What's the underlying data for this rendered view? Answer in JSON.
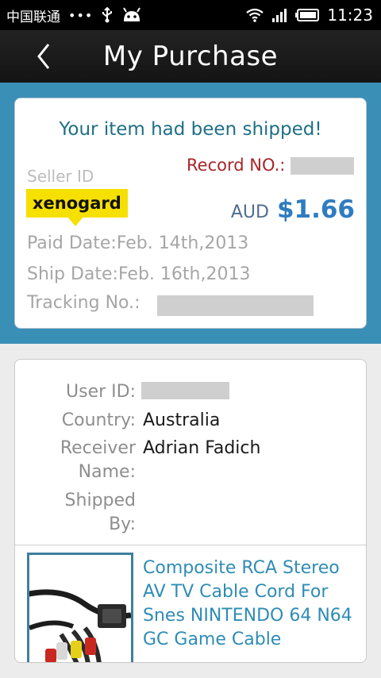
{
  "status_bar": {
    "carrier": "中国联通",
    "dots": "•••",
    "time": "11:23",
    "icons": [
      "usb-icon",
      "android-icon",
      "wifi-icon",
      "signal-icon",
      "battery-icon"
    ]
  },
  "header": {
    "title": "My Purchase",
    "back_icon": "chevron-left-icon"
  },
  "shipment": {
    "message": "Your item had been shipped!",
    "seller_label": "Seller ID",
    "seller_id": "xenogard",
    "record_label": "Record NO.:",
    "currency": "AUD",
    "price": "$1.66",
    "paid_date": "Paid Date:Feb. 14th,2013",
    "ship_date": "Ship Date:Feb. 16th,2013",
    "tracking_label": "Tracking No.:"
  },
  "receiver": {
    "user_id_label": "User ID:",
    "country_label": "Country:",
    "country": "Australia",
    "receiver_label_line1": "Receiver",
    "receiver_label_line2": "Name:",
    "receiver_name": "Adrian Fadich",
    "shipped_by_line1": "Shipped",
    "shipped_by_line2": "By:"
  },
  "product": {
    "title": "Composite RCA Stereo AV TV Cable Cord For Snes NINTENDO 64 N64 GC Game Cable"
  },
  "colors": {
    "band": "#3a8fb7",
    "message": "#1f6f86",
    "record": "#a8252a",
    "price": "#2f7cc0",
    "seller_tag": "#f6e000",
    "link": "#2f8cb5"
  }
}
